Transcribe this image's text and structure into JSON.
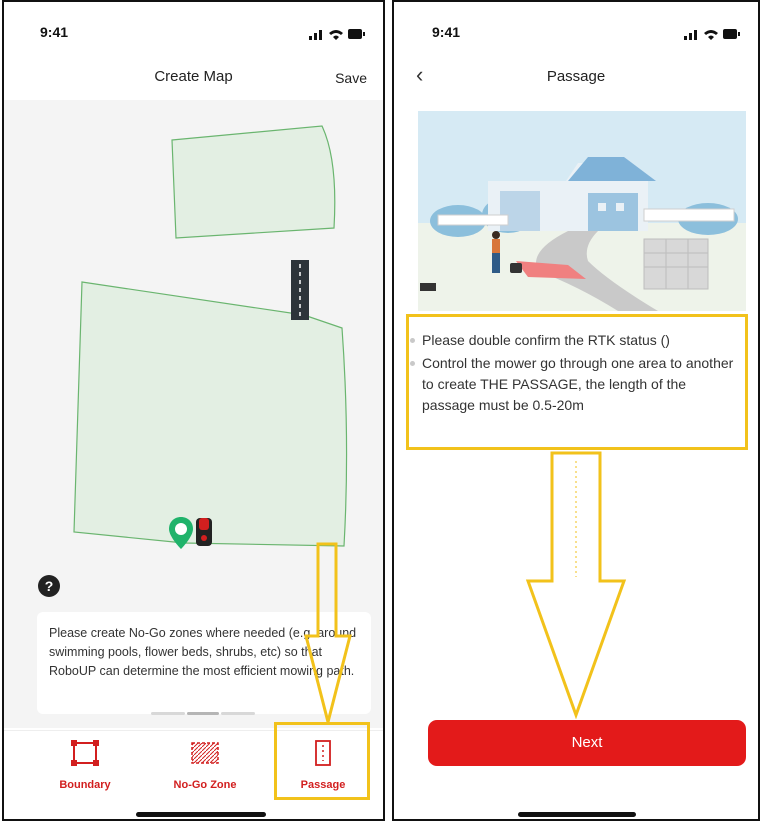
{
  "colors": {
    "accent": "#e31a1a",
    "highlight": "#f2c21b",
    "zone_fill": "#e3efe3",
    "zone_stroke": "#6ab56f"
  },
  "left_screen": {
    "status": {
      "time": "9:41"
    },
    "header": {
      "title": "Create Map",
      "save_label": "Save"
    },
    "help_label": "?",
    "tip_text": "Please create No-Go zones where needed (e.g. around swimming pools, flower beds, shrubs, etc) so that  RoboUP can determine the most efficient mowing path.",
    "tabs": [
      {
        "label": "Boundary",
        "icon": "boundary-icon"
      },
      {
        "label": "No-Go Zone",
        "icon": "nogo-zone-icon"
      },
      {
        "label": "Passage",
        "icon": "passage-icon"
      }
    ]
  },
  "right_screen": {
    "status": {
      "time": "9:41"
    },
    "header": {
      "title": "Passage",
      "back_icon": "chevron-left-icon"
    },
    "instructions": [
      "Please double confirm the RTK status ()",
      "Control the mower go through one area to another to create THE PASSAGE, the length of the passage must be 0.5-20m"
    ],
    "next_label": "Next"
  }
}
